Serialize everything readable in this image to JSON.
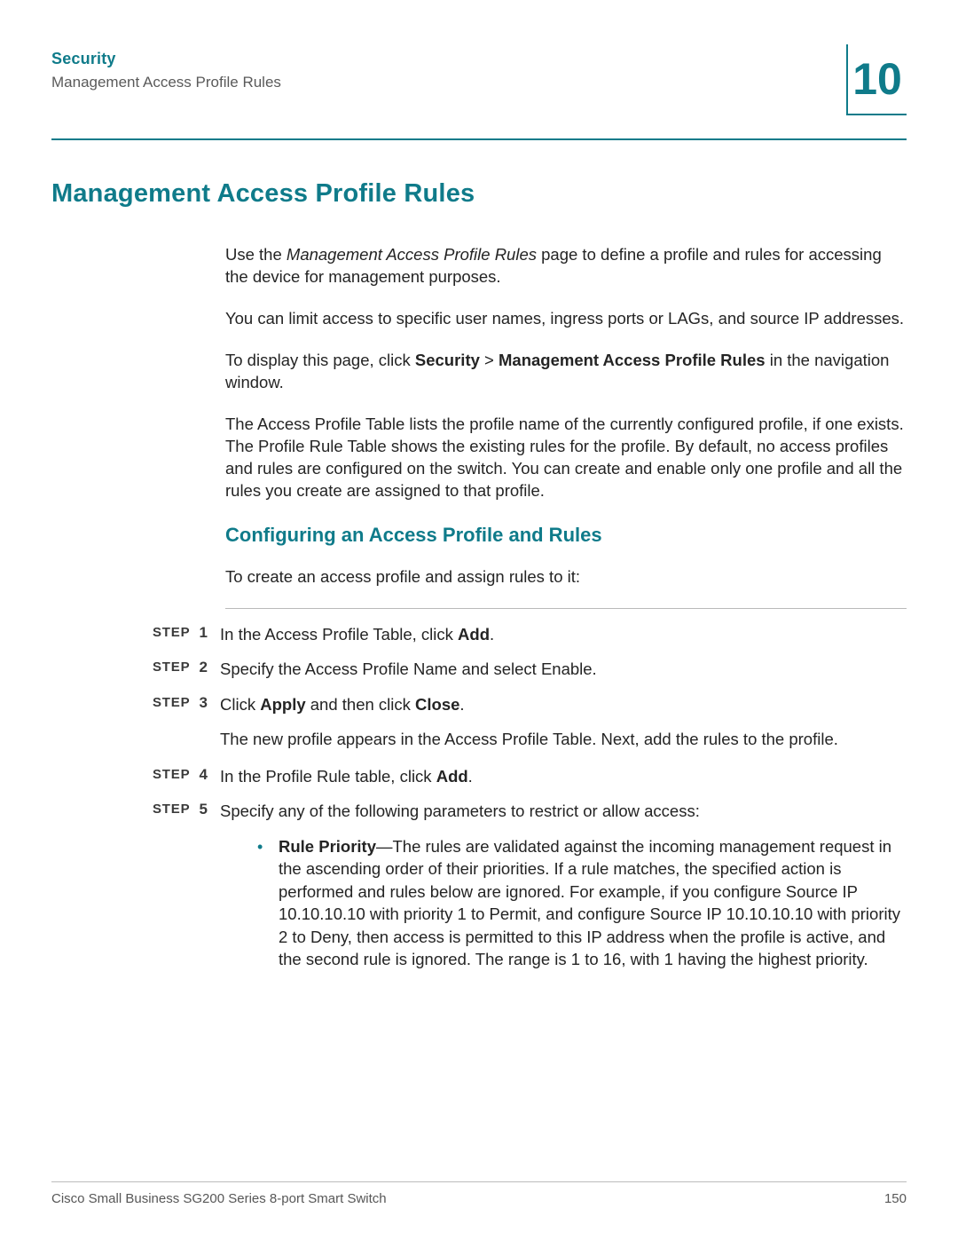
{
  "header": {
    "section": "Security",
    "subsection": "Management Access Profile Rules",
    "chapter": "10"
  },
  "title": "Management Access Profile Rules",
  "intro": {
    "p1_pre": "Use the ",
    "p1_ital": "Management Access Profile Rules",
    "p1_post": " page to define a profile and rules for accessing the device for management purposes.",
    "p2": "You can limit access to specific user names, ingress ports or LAGs, and source IP addresses.",
    "p3_pre": "To display this page, click ",
    "p3_b1": "Security",
    "p3_gt": " > ",
    "p3_b2": "Management Access Profile Rules",
    "p3_post": " in the navigation window.",
    "p4": "The Access Profile Table lists the profile name of the currently configured profile, if one exists. The Profile Rule Table shows the existing rules for the profile. By default, no access profiles and rules are configured on the switch. You can create and enable only one profile and all the rules you create are assigned to that profile."
  },
  "subheading": "Configuring an Access Profile and Rules",
  "subintro": "To create an access profile and assign rules to it:",
  "step_label": "STEP ",
  "steps": {
    "s1_pre": "In the Access Profile Table, click ",
    "s1_b": "Add",
    "s1_post": ".",
    "s2": "Specify the Access Profile Name and select Enable.",
    "s3_pre": "Click ",
    "s3_b1": "Apply",
    "s3_mid": " and then click ",
    "s3_b2": "Close",
    "s3_post": ".",
    "s3_follow": "The new profile appears in the Access Profile Table. Next, add the rules to the profile.",
    "s4_pre": "In the Profile Rule table, click ",
    "s4_b": "Add",
    "s4_post": ".",
    "s5": "Specify any of the following parameters to restrict or allow access:"
  },
  "bullet": {
    "b1_b": "Rule Priority",
    "b1_text": "—The rules are validated against the incoming management request in the ascending order of their priorities. If a rule matches, the specified action is performed and rules below are ignored. For example, if you configure Source IP 10.10.10.10 with priority 1 to Permit, and configure Source IP 10.10.10.10 with priority 2 to Deny, then access is permitted to this IP address when the profile is active, and the second rule is ignored. The range is 1 to 16, with 1 having the highest priority."
  },
  "footer": {
    "left": "Cisco Small Business SG200 Series 8-port Smart Switch",
    "right": "150"
  }
}
